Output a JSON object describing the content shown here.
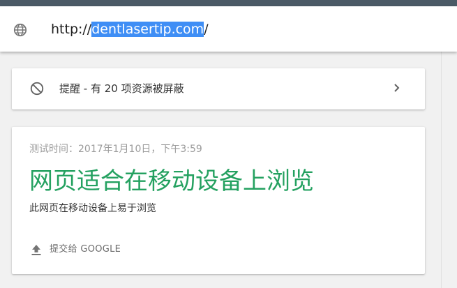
{
  "address_bar": {
    "icon": "globe-icon",
    "url_prefix": "http://",
    "url_selected": "dentlasertip.com",
    "url_suffix": "/"
  },
  "alert": {
    "icon": "block-icon",
    "text": "提醒 - 有 20 项资源被屏蔽",
    "chevron": "chevron-right-icon"
  },
  "result": {
    "test_time": "测试时间：2017年1月10日，下午3:59",
    "headline": "网页适合在移动设备上浏览",
    "subline": "此网页在移动设备上易于浏览",
    "submit_label": "提交给 GOOGLE",
    "submit_icon": "upload-icon"
  },
  "colors": {
    "top_strip": "#4b5a66",
    "selection": "#3f8ef5",
    "headline_green": "#24a160",
    "background": "#f1f1f1"
  }
}
